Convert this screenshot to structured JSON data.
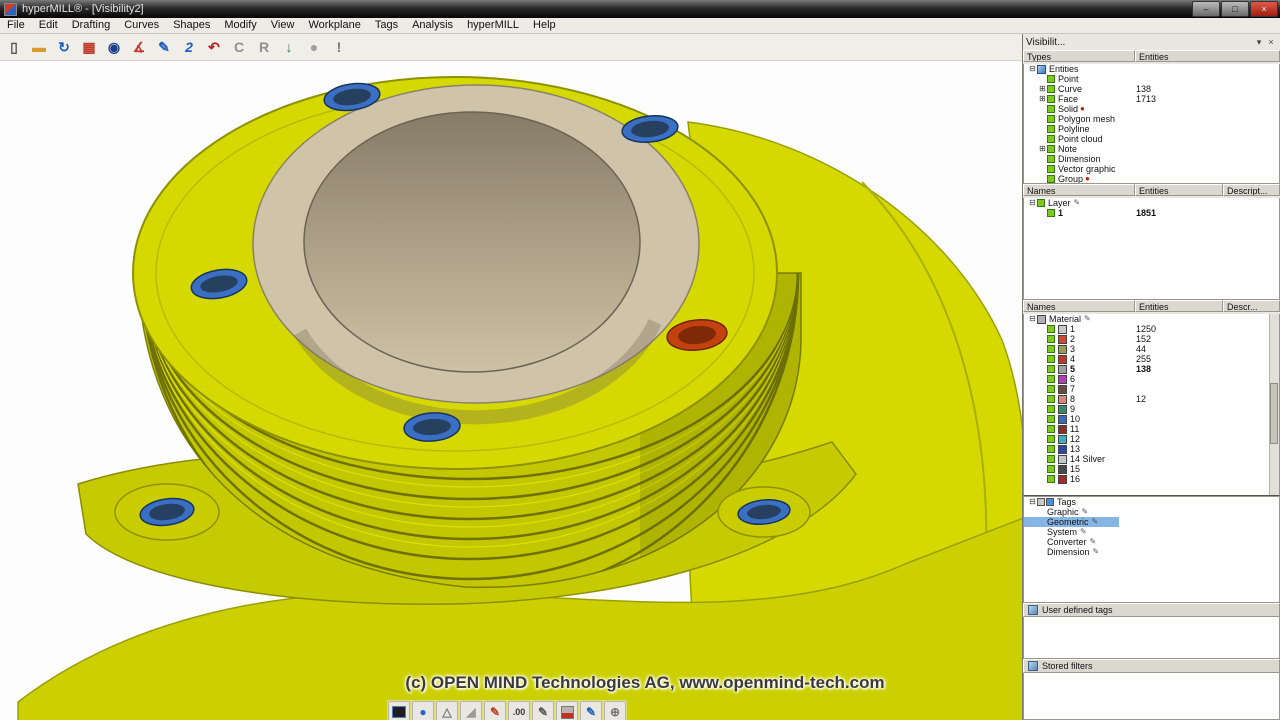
{
  "colors": {
    "canvas-bg": "#fdfdfd",
    "model-yellow": "#d5d900",
    "model-yellow-mid": "#c3c700",
    "model-yellow-deep": "#a9ad00",
    "model-edge": "#8e9100",
    "bore-beige": "#cfc4a9",
    "bore-dark": "#8a8069",
    "hole-blue": "#3b6fc4",
    "hole-blue-dark": "#27405f",
    "hole-red": "#c2410f",
    "hole-red-dark": "#7e2a08",
    "selection-blue": "#86b4e4"
  },
  "window": {
    "title": "hyperMILL® - [Visibility2]",
    "controls": [
      {
        "name": "minimize",
        "glyph": "–"
      },
      {
        "name": "maximize",
        "glyph": "□"
      },
      {
        "name": "close",
        "glyph": "×"
      }
    ]
  },
  "menubar": {
    "items": [
      "File",
      "Edit",
      "Drafting",
      "Curves",
      "Shapes",
      "Modify",
      "View",
      "Workplane",
      "Tags",
      "Analysis",
      "hyperMILL",
      "Help"
    ]
  },
  "toolbar": {
    "buttons": [
      {
        "name": "new-document",
        "glyph": "▯",
        "color": "#555555"
      },
      {
        "name": "open-folder",
        "glyph": "▬",
        "color": "#d9992b"
      },
      {
        "name": "import-sync",
        "glyph": "↻",
        "color": "#1f5fbf"
      },
      {
        "name": "print",
        "glyph": "▦",
        "color": "#c0392b"
      },
      {
        "name": "shaded-sphere",
        "glyph": "◉",
        "color": "#1a3e8c"
      },
      {
        "name": "measure-angle",
        "glyph": "∡",
        "color": "#c0392b"
      },
      {
        "name": "sketch-pencil",
        "glyph": "✎",
        "color": "#1f5fbf"
      },
      {
        "name": "sketch-2d",
        "glyph": "2",
        "color": "#1f5fbf"
      },
      {
        "name": "undo",
        "glyph": "↶",
        "color": "#b02020"
      },
      {
        "name": "copy-c",
        "glyph": "C",
        "color": "#909090"
      },
      {
        "name": "radius-r",
        "glyph": "R",
        "color": "#909090"
      },
      {
        "name": "export-down",
        "glyph": "↓",
        "color": "#2e7d32"
      },
      {
        "name": "render-sphere",
        "glyph": "●",
        "color": "#9e9e9e"
      },
      {
        "name": "info-exclaim",
        "glyph": "!",
        "color": "#777777"
      }
    ]
  },
  "canvas": {
    "watermark": "(c) OPEN MIND Technologies AG, www.openmind-tech.com"
  },
  "bottom_toolbar": {
    "buttons": [
      {
        "name": "background-dark",
        "glyph": "",
        "shape": "dark-sq"
      },
      {
        "name": "shaded-view",
        "glyph": "●",
        "color": "#2864c8"
      },
      {
        "name": "wireframe-view",
        "glyph": "△",
        "color": "#777777"
      },
      {
        "name": "slope-angle",
        "glyph": "◢",
        "color": "#999999"
      },
      {
        "name": "marker-pen",
        "glyph": "✎",
        "color": "#c0392b"
      },
      {
        "name": "decimal-precision",
        "glyph": ".00",
        "color": "#333333"
      },
      {
        "name": "edit-pencil",
        "glyph": "✎",
        "color": "#555555"
      },
      {
        "name": "fill-color",
        "glyph": "",
        "shape": "red-fill"
      },
      {
        "name": "draw-pencil",
        "glyph": "✎",
        "color": "#1f5fbf"
      },
      {
        "name": "view-target",
        "glyph": "⊕",
        "color": "#777777"
      }
    ]
  },
  "panel": {
    "title": "Visibilit...",
    "header_icons": [
      {
        "name": "panel-menu",
        "glyph": "▾"
      },
      {
        "name": "panel-close",
        "glyph": "×"
      }
    ],
    "types": {
      "header": {
        "col1": "Types",
        "col2": "Entities"
      },
      "rows": [
        {
          "expander": "minus",
          "icon": "cube",
          "label": "Entities",
          "count": "",
          "indent": 0
        },
        {
          "icon": "green",
          "label": "Point",
          "count": "",
          "indent": 1
        },
        {
          "expander": "plus",
          "icon": "green",
          "label": "Curve",
          "count": "138",
          "indent": 1
        },
        {
          "expander": "plus",
          "icon": "green",
          "label": "Face",
          "count": "1713",
          "indent": 1
        },
        {
          "icon": "green",
          "label": "Solid",
          "extra": "red-dot",
          "count": "",
          "indent": 1
        },
        {
          "icon": "green",
          "label": "Polygon mesh",
          "count": "",
          "indent": 1
        },
        {
          "icon": "green",
          "label": "Polyline",
          "count": "",
          "indent": 1
        },
        {
          "icon": "green",
          "label": "Point cloud",
          "count": "",
          "indent": 1
        },
        {
          "expander": "plus",
          "icon": "green",
          "label": "Note",
          "count": "",
          "indent": 1
        },
        {
          "icon": "green",
          "label": "Dimension",
          "count": "",
          "indent": 1
        },
        {
          "icon": "green",
          "label": "Vector graphic",
          "count": "",
          "indent": 1
        },
        {
          "icon": "green",
          "label": "Group",
          "extra": "red-dot",
          "count": "",
          "indent": 1
        }
      ]
    },
    "names": {
      "header": {
        "col1": "Names",
        "col2": "Entities",
        "col3": "Descript..."
      },
      "rows": [
        {
          "expander": "minus",
          "icon": "green",
          "label": "Layer",
          "pencil": true,
          "count": "",
          "indent": 0
        },
        {
          "icon": "green",
          "label": "1",
          "bold": true,
          "count": "1851",
          "indent": 1
        }
      ]
    },
    "materials": {
      "header": {
        "col1": "Names",
        "col2": "Entities",
        "col3": "Descr..."
      },
      "rows": [
        {
          "expander": "minus",
          "swatch": "#b0b0b8",
          "label": "Material",
          "pencil": true,
          "count": "",
          "indent": 0
        },
        {
          "icon": "green",
          "swatch": "#c8c8c8",
          "label": "1",
          "count": "1250",
          "indent": 1
        },
        {
          "icon": "green",
          "swatch": "#d04830",
          "label": "2",
          "count": "152",
          "indent": 1
        },
        {
          "icon": "green",
          "swatch": "#9a9a50",
          "label": "3",
          "count": "44",
          "indent": 1
        },
        {
          "icon": "green",
          "swatch": "#c03828",
          "label": "4",
          "count": "255",
          "indent": 1
        },
        {
          "icon": "green",
          "swatch": "#a0a0a0",
          "label": "5",
          "bold": true,
          "count": "138",
          "indent": 1
        },
        {
          "icon": "green",
          "swatch": "#b43cb4",
          "label": "6",
          "count": "",
          "indent": 1
        },
        {
          "icon": "green",
          "swatch": "#6a4a3a",
          "label": "7",
          "count": "",
          "indent": 1
        },
        {
          "icon": "green",
          "swatch": "#d88878",
          "label": "8",
          "count": "12",
          "indent": 1
        },
        {
          "icon": "green",
          "swatch": "#3a8a6a",
          "label": "9",
          "count": "",
          "indent": 1
        },
        {
          "icon": "green",
          "swatch": "#3a6ab8",
          "label": "10",
          "count": "",
          "indent": 1
        },
        {
          "icon": "green",
          "swatch": "#8a3028",
          "label": "11",
          "count": "",
          "indent": 1
        },
        {
          "icon": "green",
          "swatch": "#38b0c0",
          "label": "12",
          "count": "",
          "indent": 1
        },
        {
          "icon": "green",
          "swatch": "#2848a8",
          "label": "13",
          "count": "",
          "indent": 1
        },
        {
          "icon": "green",
          "swatch": "#c4c4cc",
          "label": "14 Silver",
          "count": "",
          "indent": 1
        },
        {
          "icon": "green",
          "swatch": "#484848",
          "label": "15",
          "count": "",
          "indent": 1
        },
        {
          "icon": "green",
          "swatch": "#a82828",
          "label": "16",
          "count": "",
          "indent": 1
        }
      ]
    },
    "tags": {
      "rows": [
        {
          "expander": "minus",
          "icon": "tag",
          "label": "Tags",
          "indent": 0
        },
        {
          "label": "Graphic",
          "pencil": true,
          "indent": 1
        },
        {
          "label": "Geometric",
          "pencil": true,
          "selected": true,
          "indent": 1
        },
        {
          "label": "System",
          "pencil": true,
          "indent": 1
        },
        {
          "label": "Converter",
          "pencil": true,
          "indent": 1
        },
        {
          "label": "Dimension",
          "pencil": true,
          "indent": 1
        }
      ]
    },
    "user_tags_label": "User defined tags",
    "stored_filters_label": "Stored filters"
  }
}
